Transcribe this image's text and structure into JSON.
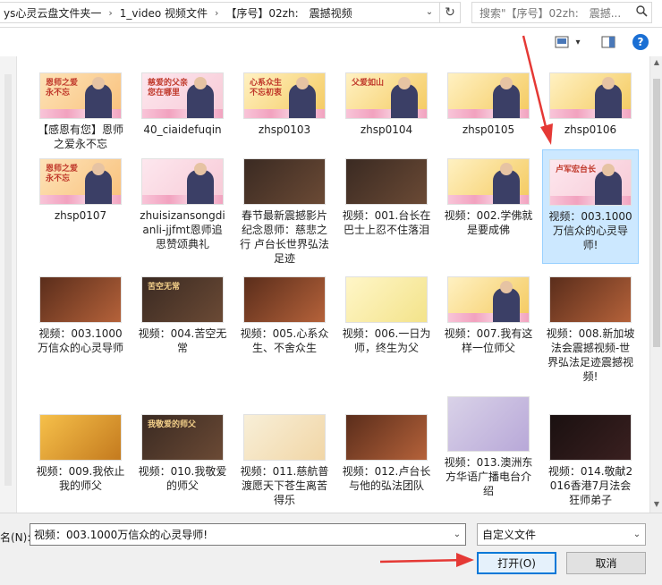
{
  "address": {
    "crumbs": [
      "ys心灵云盘文件夹一",
      "1_video 视频文件",
      "【序号】02zh:　震撼视频"
    ],
    "separator": "›",
    "dropdown_glyph": "⌄",
    "refresh_glyph": "↻"
  },
  "search": {
    "placeholder": "搜索\"【序号】02zh:　震撼...",
    "icon": "search-icon"
  },
  "toolbar": {
    "view_icon": "thumbnail-view-icon",
    "view_caret": "▾",
    "pane_icon": "preview-pane-icon",
    "help_glyph": "?"
  },
  "colors": {
    "selected_bg": "#cce8ff",
    "selected_border": "#99d1ff",
    "primary_border": "#0078d7",
    "annotation_red": "#e53935"
  },
  "items": [
    {
      "label": "【感恩有您】恩师之爱永不忘",
      "thumb_text": "恩师之爱\n永不忘",
      "style": "warm"
    },
    {
      "label": "40_ciaidefuqin",
      "thumb_text": "慈爱的父亲\n您在哪里",
      "style": "pink"
    },
    {
      "label": "zhsp0103",
      "thumb_text": "心系众生\n不忘初衷",
      "style": "gold"
    },
    {
      "label": "zhsp0104",
      "thumb_text": "父爱如山",
      "style": "gold"
    },
    {
      "label": "zhsp0105",
      "thumb_text": "",
      "style": "gold"
    },
    {
      "label": "zhsp0106",
      "thumb_text": "",
      "style": "gold"
    },
    {
      "label": "zhsp0107",
      "thumb_text": "恩师之爱\n永不忘",
      "style": "warm"
    },
    {
      "label": "zhuisizansongdianli-jjfmt恩师追思赞颂典礼",
      "thumb_text": "",
      "style": "pink"
    },
    {
      "label": "春节最新震撼影片 纪念恩师：慈悲之行 卢台长世界弘法足迹",
      "thumb_text": "",
      "style": "dark"
    },
    {
      "label": "视频：001.台长在巴士上忍不住落泪",
      "thumb_text": "",
      "style": "dark"
    },
    {
      "label": "视频：002.学佛就是要成佛",
      "thumb_text": "",
      "style": "gold"
    },
    {
      "label": "视频：003.1000万信众的心灵导师!",
      "thumb_text": "卢军宏台长",
      "style": "pink",
      "selected": true
    },
    {
      "label": "视频：003.1000万信众的心灵导师",
      "thumb_text": "",
      "style": "crowd"
    },
    {
      "label": "视频：004.苦空无常",
      "thumb_text": "苦空无常",
      "style": "dark"
    },
    {
      "label": "视频：005.心系众生、不舍众生",
      "thumb_text": "",
      "style": "crowd"
    },
    {
      "label": "视频：006.一日为师，终生为父",
      "thumb_text": "",
      "style": "yellowtext"
    },
    {
      "label": "视频：007.我有这样一位师父",
      "thumb_text": "",
      "style": "gold"
    },
    {
      "label": "视频：008.新加坡法会震撼视频-世界弘法足迹震撼视频!",
      "thumb_text": "",
      "style": "crowd"
    },
    {
      "label": "视频：009.我依止我的师父",
      "thumb_text": "",
      "style": "book"
    },
    {
      "label": "视频：010.我敬爱的师父",
      "thumb_text": "我敬爱的师父",
      "style": "dark"
    },
    {
      "label": "视频：011.慈航普渡愿天下苍生离苦得乐",
      "thumb_text": "",
      "style": "light"
    },
    {
      "label": "视频：012.卢台长与他的弘法团队",
      "thumb_text": "",
      "style": "crowd"
    },
    {
      "label": "视频：013.澳洲东方华语广播电台介绍",
      "thumb_text": "",
      "style": "poster"
    },
    {
      "label": "视频：014.敬献2016香港7月法会狂师弟子",
      "thumb_text": "",
      "style": "darkflower"
    }
  ],
  "filename": {
    "label": "名(N):",
    "value": "视频：003.1000万信众的心灵导师!",
    "caret": "⌄"
  },
  "filetype": {
    "value": "自定义文件",
    "caret": "⌄"
  },
  "buttons": {
    "open": "打开(O)",
    "cancel": "取消"
  },
  "scroll": {
    "up": "▲",
    "down": "▼"
  }
}
